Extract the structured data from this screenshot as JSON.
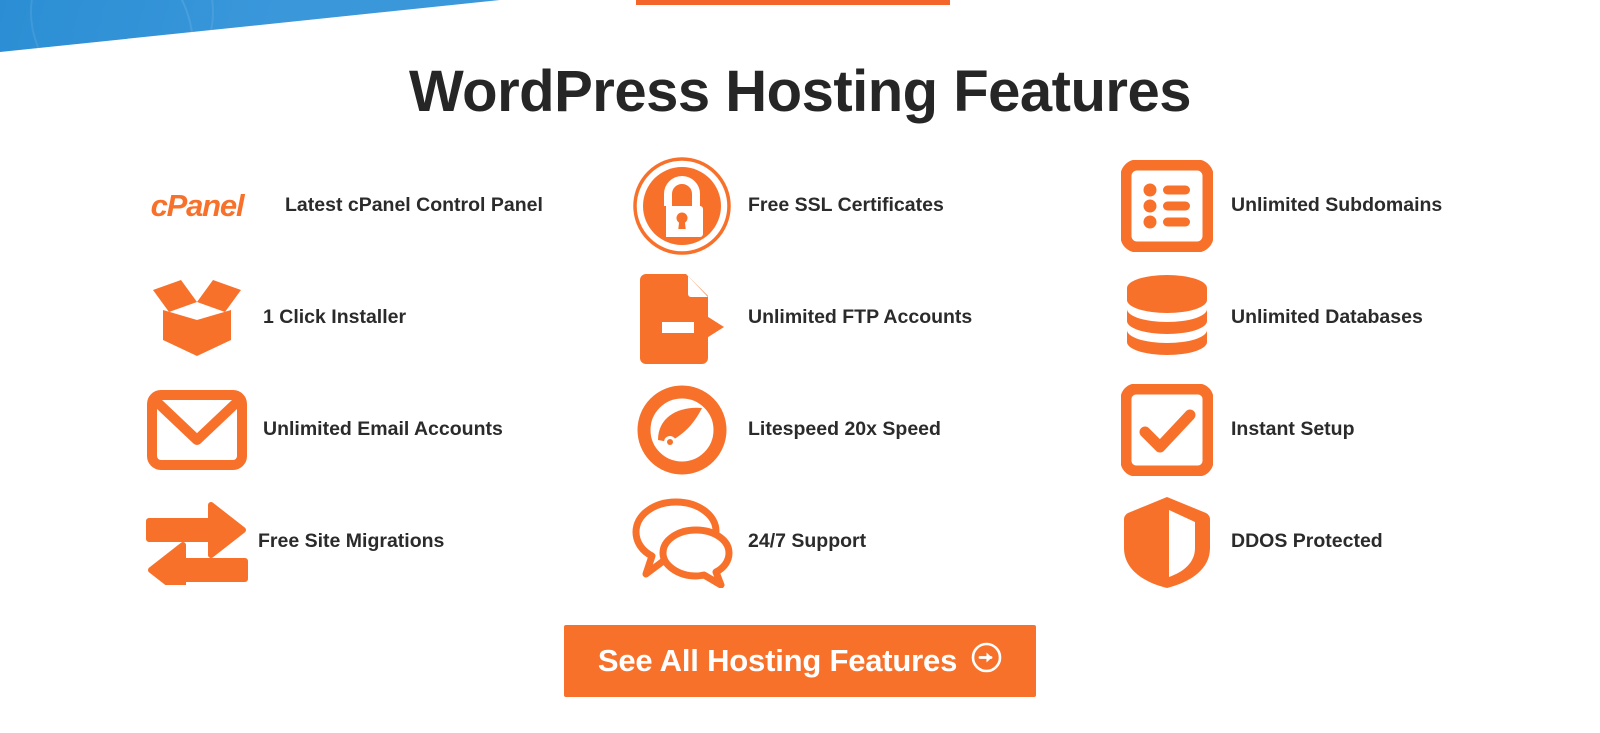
{
  "page": {
    "title": "WordPress Hosting Features",
    "background_color": "#ffffff",
    "accent_color": "#f8712b",
    "secondary_color": "#3494d8",
    "text_color": "#2b2b2b"
  },
  "decorations": {
    "blue_swoosh_name": "blue-diagonal-banner",
    "orange_tab_name": "orange-top-accent-bar"
  },
  "features": [
    {
      "icon": "cpanel-logo-icon",
      "label": "Latest cPanel Control Panel",
      "brand_text": "cPanel"
    },
    {
      "icon": "padlock-circle-icon",
      "label": "Free SSL Certificates"
    },
    {
      "icon": "bulleted-list-box-icon",
      "label": "Unlimited Subdomains"
    },
    {
      "icon": "open-box-icon",
      "label": "1 Click Installer"
    },
    {
      "icon": "document-arrow-icon",
      "label": "Unlimited FTP Accounts"
    },
    {
      "icon": "database-cylinder-icon",
      "label": "Unlimited Databases"
    },
    {
      "icon": "envelope-icon",
      "label": "Unlimited Email Accounts"
    },
    {
      "icon": "speedometer-icon",
      "label": "Litespeed 20x Speed"
    },
    {
      "icon": "checkbox-check-icon",
      "label": "Instant Setup"
    },
    {
      "icon": "two-way-arrows-icon",
      "label": "Free Site Migrations"
    },
    {
      "icon": "speech-bubbles-icon",
      "label": "24/7 Support"
    },
    {
      "icon": "shield-icon",
      "label": "DDOS Protected"
    }
  ],
  "cta": {
    "label": "See All Hosting Features",
    "icon": "circle-arrow-right-icon"
  }
}
